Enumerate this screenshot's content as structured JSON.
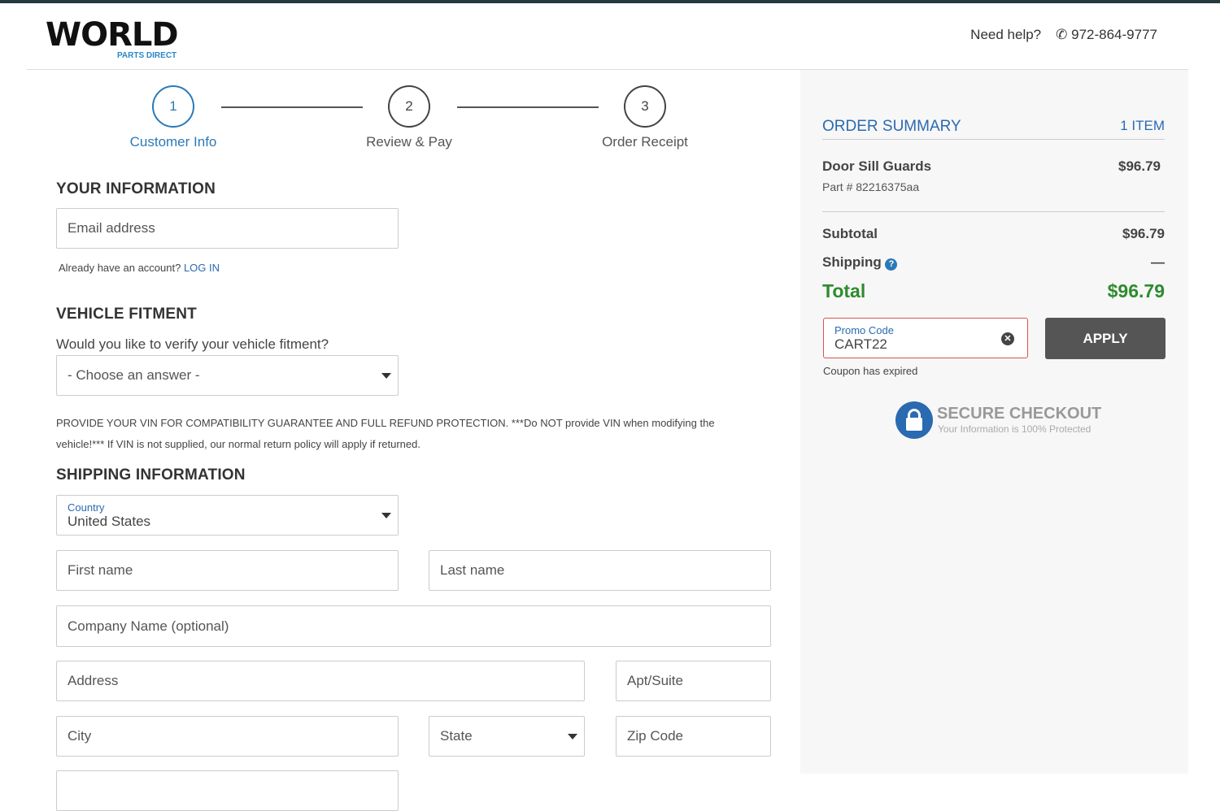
{
  "header": {
    "logo_text": "WORLD",
    "logo_sub": "PARTS DIRECT",
    "help_label": "Need help?",
    "phone": "972-864-9777"
  },
  "steps": [
    {
      "num": "1",
      "label": "Customer Info"
    },
    {
      "num": "2",
      "label": "Review & Pay"
    },
    {
      "num": "3",
      "label": "Order Receipt"
    }
  ],
  "your_info": {
    "title": "YOUR INFORMATION",
    "email_placeholder": "Email address",
    "account_text": "Already have an account?",
    "login_link": "LOG IN"
  },
  "fitment": {
    "title": "VEHICLE FITMENT",
    "question": "Would you like to verify your vehicle fitment?",
    "select_value": "- Choose an answer -",
    "notice": "PROVIDE YOUR VIN FOR COMPATIBILITY GUARANTEE AND FULL REFUND PROTECTION. ***Do NOT provide VIN when modifying the vehicle!*** If VIN is not supplied, our normal return policy will apply if returned."
  },
  "shipping": {
    "title": "SHIPPING INFORMATION",
    "country_label": "Country",
    "country_value": "United States",
    "first_name": "First name",
    "last_name": "Last name",
    "company": "Company Name (optional)",
    "address": "Address",
    "apt": "Apt/Suite",
    "city": "City",
    "state": "State",
    "zip": "Zip Code"
  },
  "summary": {
    "title": "ORDER SUMMARY",
    "count": "1 ITEM",
    "item_name": "Door Sill Guards",
    "item_part": "Part # 82216375aa",
    "item_price": "$96.79",
    "subtotal_label": "Subtotal",
    "subtotal": "$96.79",
    "shipping_label": "Shipping",
    "shipping": "—",
    "total_label": "Total",
    "total": "$96.79",
    "promo_label": "Promo Code",
    "promo_value": "CART22",
    "apply": "APPLY",
    "promo_error": "Coupon has expired",
    "secure_title": "SECURE CHECKOUT",
    "secure_sub": "Your Information is 100% Protected"
  },
  "colors": {
    "accent": "#2a7ab8",
    "total": "#2e8b2e",
    "error": "#d9534f",
    "button": "#555555"
  }
}
